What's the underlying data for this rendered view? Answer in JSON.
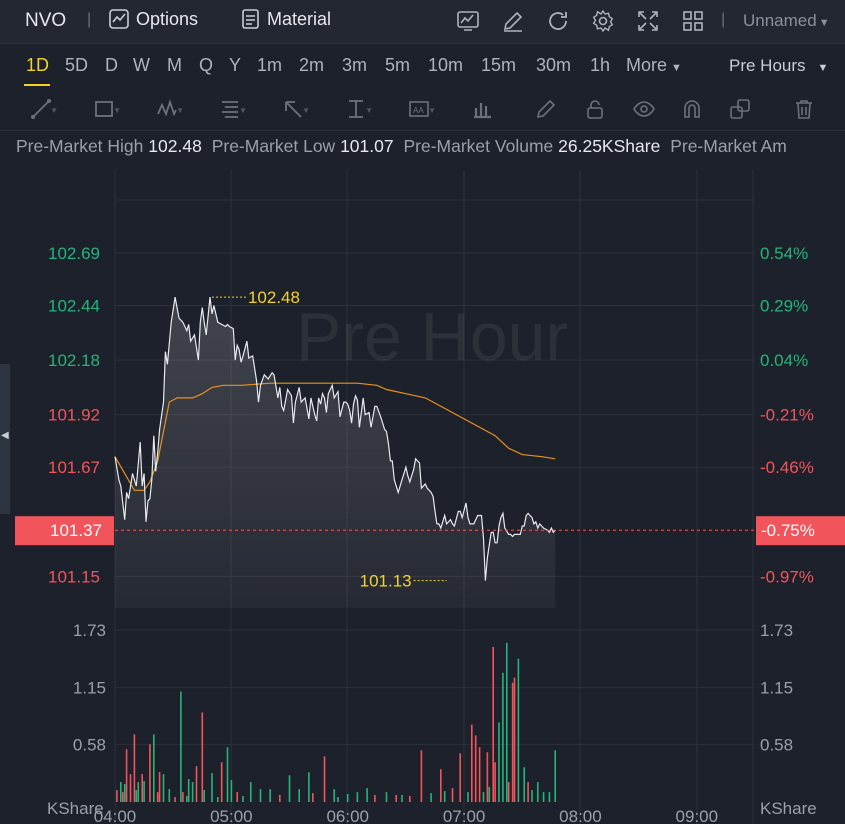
{
  "header": {
    "symbol": "NVO",
    "options_label": "Options",
    "material_label": "Material",
    "layout_name": "Unnamed",
    "icons": [
      "chart-icon",
      "edit-icon",
      "refresh-icon",
      "settings-icon",
      "fullscreen-icon",
      "grid-icon"
    ]
  },
  "timeframes": {
    "items": [
      "1D",
      "5D",
      "D",
      "W",
      "M",
      "Q",
      "Y",
      "1m",
      "2m",
      "3m",
      "5m",
      "10m",
      "15m",
      "30m",
      "1h"
    ],
    "active": "1D",
    "more_label": "More",
    "session_label": "Pre Hours"
  },
  "drawing_tools": [
    "trendline-icon",
    "rectangle-icon",
    "wave-icon",
    "fib-icon",
    "arrow-icon",
    "measure-icon",
    "text-icon",
    "bars-icon",
    "pencil-icon",
    "lock-icon",
    "eye-icon",
    "magnet-icon",
    "layers-icon",
    "trash-icon"
  ],
  "stats": {
    "high_label": "Pre-Market High",
    "high_value": "102.48",
    "low_label": "Pre-Market Low",
    "low_value": "101.07",
    "volume_label": "Pre-Market Volume",
    "volume_value": "26.25KShare",
    "amount_label": "Pre-Market Am"
  },
  "colors": {
    "up": "#26b47a",
    "down": "#f2545b",
    "price_line": "#e6e8ee",
    "avg_line": "#e8921c",
    "marker": "#f4d22b",
    "bg": "#1d212b"
  },
  "chart_data": {
    "type": "line",
    "watermark": "Pre Hour",
    "current_price": "101.37",
    "current_pct": "-0.75%",
    "price_axis_left": [
      {
        "label": "102.69",
        "value": 102.69,
        "dir": "up"
      },
      {
        "label": "102.44",
        "value": 102.44,
        "dir": "up"
      },
      {
        "label": "102.18",
        "value": 102.18,
        "dir": "up"
      },
      {
        "label": "101.92",
        "value": 101.92,
        "dir": "down"
      },
      {
        "label": "101.67",
        "value": 101.67,
        "dir": "down"
      },
      {
        "label": "101.15",
        "value": 101.15,
        "dir": "down"
      }
    ],
    "price_axis_right": [
      "0.54%",
      "0.29%",
      "0.04%",
      "-0.21%",
      "-0.46%",
      "-0.97%"
    ],
    "x_ticks": [
      "04:00",
      "05:00",
      "06:00",
      "07:00",
      "08:00",
      "09:00"
    ],
    "x_range_minutes": [
      0,
      330
    ],
    "y_range": [
      101.0,
      102.8
    ],
    "max_marker": {
      "label": "102.48",
      "t": 50,
      "v": 102.48
    },
    "min_marker": {
      "label": "101.13",
      "t": 171,
      "v": 101.13
    },
    "price_series": [
      [
        0,
        101.72
      ],
      [
        2,
        101.61
      ],
      [
        3,
        101.58
      ],
      [
        5,
        101.42
      ],
      [
        6,
        101.55
      ],
      [
        7,
        101.52
      ],
      [
        9,
        101.64
      ],
      [
        11,
        101.58
      ],
      [
        13,
        101.79
      ],
      [
        14,
        101.58
      ],
      [
        15,
        101.64
      ],
      [
        16,
        101.41
      ],
      [
        17,
        101.51
      ],
      [
        18,
        101.52
      ],
      [
        19,
        101.61
      ],
      [
        20,
        101.82
      ],
      [
        21,
        101.65
      ],
      [
        22,
        101.74
      ],
      [
        23,
        101.85
      ],
      [
        25,
        101.98
      ],
      [
        26,
        102.22
      ],
      [
        27,
        102.16
      ],
      [
        29,
        102.36
      ],
      [
        31,
        102.48
      ],
      [
        33,
        102.38
      ],
      [
        35,
        102.36
      ],
      [
        37,
        102.32
      ],
      [
        38,
        102.35
      ],
      [
        39,
        102.27
      ],
      [
        41,
        102.3
      ],
      [
        43,
        102.18
      ],
      [
        44,
        102.36
      ],
      [
        45,
        102.43
      ],
      [
        46,
        102.36
      ],
      [
        47,
        102.3
      ],
      [
        49,
        102.48
      ],
      [
        50,
        102.4
      ],
      [
        51,
        102.44
      ],
      [
        53,
        102.36
      ],
      [
        55,
        102.35
      ],
      [
        57,
        102.34
      ],
      [
        58,
        102.35
      ],
      [
        59,
        102.34
      ],
      [
        61,
        102.33
      ],
      [
        62,
        102.18
      ],
      [
        63,
        102.25
      ],
      [
        64,
        102.23
      ],
      [
        65,
        102.17
      ],
      [
        66,
        102.2
      ],
      [
        68,
        102.27
      ],
      [
        69,
        102.19
      ],
      [
        71,
        102.2
      ],
      [
        73,
        102.08
      ],
      [
        74,
        101.98
      ],
      [
        75,
        102.06
      ],
      [
        77,
        102.11
      ],
      [
        79,
        102.09
      ],
      [
        81,
        102.12
      ],
      [
        82,
        102.11
      ],
      [
        84,
        102.0
      ],
      [
        85,
        102.05
      ],
      [
        86,
        101.96
      ],
      [
        87,
        101.94
      ],
      [
        89,
        102.04
      ],
      [
        91,
        102.01
      ],
      [
        92,
        101.88
      ],
      [
        93,
        101.98
      ],
      [
        95,
        102.05
      ],
      [
        96,
        101.98
      ],
      [
        98,
        102.0
      ],
      [
        100,
        101.9
      ],
      [
        101,
        102.0
      ],
      [
        102,
        101.96
      ],
      [
        103,
        101.92
      ],
      [
        104,
        101.89
      ],
      [
        105,
        102.0
      ],
      [
        106,
        101.97
      ],
      [
        107,
        102.02
      ],
      [
        108,
        102.0
      ],
      [
        109,
        101.93
      ],
      [
        110,
        102.02
      ],
      [
        112,
        102.06
      ],
      [
        113,
        102.0
      ],
      [
        115,
        102.03
      ],
      [
        116,
        101.91
      ],
      [
        118,
        101.98
      ],
      [
        119,
        101.98
      ],
      [
        120,
        101.97
      ],
      [
        121,
        101.94
      ],
      [
        122,
        101.88
      ],
      [
        123,
        101.97
      ],
      [
        124,
        102.01
      ],
      [
        125,
        101.99
      ],
      [
        126,
        101.86
      ],
      [
        127,
        101.93
      ],
      [
        128,
        102.0
      ],
      [
        129,
        101.92
      ],
      [
        131,
        101.93
      ],
      [
        132,
        101.86
      ],
      [
        134,
        101.96
      ],
      [
        135,
        101.96
      ],
      [
        137,
        101.91
      ],
      [
        139,
        101.85
      ],
      [
        140,
        101.84
      ],
      [
        141,
        101.78
      ],
      [
        142,
        101.7
      ],
      [
        143,
        101.7
      ],
      [
        144,
        101.61
      ],
      [
        146,
        101.55
      ],
      [
        148,
        101.61
      ],
      [
        150,
        101.67
      ],
      [
        151,
        101.63
      ],
      [
        152,
        101.6
      ],
      [
        154,
        101.66
      ],
      [
        155,
        101.71
      ],
      [
        157,
        101.69
      ],
      [
        158,
        101.57
      ],
      [
        160,
        101.59
      ],
      [
        161,
        101.57
      ],
      [
        163,
        101.55
      ],
      [
        164,
        101.53
      ],
      [
        165,
        101.46
      ],
      [
        166,
        101.4
      ],
      [
        167,
        101.4
      ],
      [
        168,
        101.38
      ],
      [
        170,
        101.44
      ],
      [
        171,
        101.4
      ],
      [
        173,
        101.42
      ],
      [
        174,
        101.4
      ],
      [
        175,
        101.39
      ],
      [
        177,
        101.46
      ],
      [
        178,
        101.46
      ],
      [
        179,
        101.43
      ],
      [
        181,
        101.5
      ],
      [
        182,
        101.43
      ],
      [
        183,
        101.4
      ],
      [
        185,
        101.4
      ],
      [
        186,
        101.42
      ],
      [
        187,
        101.44
      ],
      [
        189,
        101.44
      ],
      [
        190,
        101.33
      ],
      [
        191,
        101.13
      ],
      [
        192,
        101.24
      ],
      [
        193,
        101.3
      ],
      [
        194,
        101.36
      ],
      [
        195,
        101.36
      ],
      [
        196,
        101.31
      ],
      [
        197,
        101.31
      ],
      [
        198,
        101.39
      ],
      [
        199,
        101.43
      ],
      [
        200,
        101.45
      ],
      [
        201,
        101.38
      ],
      [
        203,
        101.35
      ],
      [
        204,
        101.35
      ],
      [
        205,
        101.34
      ],
      [
        206,
        101.35
      ],
      [
        207,
        101.35
      ],
      [
        209,
        101.35
      ],
      [
        210,
        101.39
      ],
      [
        211,
        101.39
      ],
      [
        212,
        101.44
      ],
      [
        213,
        101.45
      ],
      [
        214,
        101.44
      ],
      [
        215,
        101.43
      ],
      [
        216,
        101.4
      ],
      [
        217,
        101.41
      ],
      [
        218,
        101.38
      ],
      [
        219,
        101.4
      ],
      [
        221,
        101.38
      ],
      [
        223,
        101.37
      ],
      [
        224,
        101.36
      ],
      [
        225,
        101.38
      ],
      [
        226,
        101.36
      ],
      [
        227,
        101.37
      ]
    ],
    "avg_series": [
      [
        0,
        101.72
      ],
      [
        10,
        101.56
      ],
      [
        15,
        101.56
      ],
      [
        18,
        101.6
      ],
      [
        22,
        101.7
      ],
      [
        28,
        101.98
      ],
      [
        32,
        102.0
      ],
      [
        40,
        102.0
      ],
      [
        45,
        102.02
      ],
      [
        50,
        102.05
      ],
      [
        56,
        102.06
      ],
      [
        65,
        102.06
      ],
      [
        80,
        102.07
      ],
      [
        100,
        102.07
      ],
      [
        125,
        102.07
      ],
      [
        135,
        102.06
      ],
      [
        140,
        102.04
      ],
      [
        150,
        102.02
      ],
      [
        160,
        102.0
      ],
      [
        170,
        101.95
      ],
      [
        180,
        101.9
      ],
      [
        190,
        101.85
      ],
      [
        196,
        101.82
      ],
      [
        203,
        101.76
      ],
      [
        210,
        101.73
      ],
      [
        220,
        101.72
      ],
      [
        227,
        101.71
      ]
    ],
    "volume_axis": [
      "1.73",
      "1.15",
      "0.58",
      "KShare"
    ],
    "volume_max": 1.9,
    "volume": [
      [
        1,
        0.12,
        "down"
      ],
      [
        3,
        0.2,
        "up"
      ],
      [
        4,
        0.1,
        "down"
      ],
      [
        5,
        0.18,
        "up"
      ],
      [
        6,
        0.53,
        "down"
      ],
      [
        8,
        0.28,
        "down"
      ],
      [
        10,
        0.68,
        "down"
      ],
      [
        11,
        0.12,
        "up"
      ],
      [
        12,
        0.2,
        "up"
      ],
      [
        14,
        0.28,
        "down"
      ],
      [
        15,
        0.21,
        "up"
      ],
      [
        18,
        0.58,
        "down"
      ],
      [
        20,
        0.68,
        "up"
      ],
      [
        22,
        0.1,
        "down"
      ],
      [
        23,
        0.3,
        "down"
      ],
      [
        25,
        0.28,
        "up"
      ],
      [
        28,
        0.13,
        "up"
      ],
      [
        31,
        0.05,
        "down"
      ],
      [
        34,
        1.11,
        "up"
      ],
      [
        35,
        0.1,
        "down"
      ],
      [
        37,
        0.06,
        "up"
      ],
      [
        38,
        0.23,
        "up"
      ],
      [
        40,
        0.2,
        "up"
      ],
      [
        42,
        0.36,
        "down"
      ],
      [
        45,
        0.9,
        "down"
      ],
      [
        46,
        0.12,
        "up"
      ],
      [
        50,
        0.29,
        "up"
      ],
      [
        53,
        0.05,
        "up"
      ],
      [
        55,
        0.4,
        "down"
      ],
      [
        58,
        0.55,
        "up"
      ],
      [
        60,
        0.22,
        "up"
      ],
      [
        63,
        0.1,
        "down"
      ],
      [
        66,
        0.06,
        "up"
      ],
      [
        70,
        0.2,
        "up"
      ],
      [
        75,
        0.13,
        "up"
      ],
      [
        80,
        0.13,
        "up"
      ],
      [
        85,
        0.07,
        "down"
      ],
      [
        90,
        0.27,
        "up"
      ],
      [
        95,
        0.13,
        "up"
      ],
      [
        100,
        0.3,
        "up"
      ],
      [
        102,
        0.09,
        "down"
      ],
      [
        108,
        0.46,
        "down"
      ],
      [
        113,
        0.13,
        "up"
      ],
      [
        115,
        0.05,
        "up"
      ],
      [
        120,
        0.08,
        "up"
      ],
      [
        125,
        0.1,
        "up"
      ],
      [
        130,
        0.14,
        "up"
      ],
      [
        134,
        0.07,
        "down"
      ],
      [
        140,
        0.1,
        "up"
      ],
      [
        145,
        0.07,
        "down"
      ],
      [
        148,
        0.07,
        "up"
      ],
      [
        152,
        0.06,
        "down"
      ],
      [
        158,
        0.52,
        "down"
      ],
      [
        163,
        0.09,
        "up"
      ],
      [
        168,
        0.33,
        "down"
      ],
      [
        170,
        0.11,
        "up"
      ],
      [
        174,
        0.14,
        "down"
      ],
      [
        178,
        0.49,
        "down"
      ],
      [
        182,
        0.1,
        "up"
      ],
      [
        184,
        0.78,
        "down"
      ],
      [
        186,
        0.67,
        "down"
      ],
      [
        188,
        0.55,
        "down"
      ],
      [
        190,
        0.1,
        "up"
      ],
      [
        192,
        0.5,
        "down"
      ],
      [
        193,
        0.15,
        "up"
      ],
      [
        195,
        1.56,
        "down"
      ],
      [
        196,
        0.4,
        "down"
      ],
      [
        198,
        0.8,
        "up"
      ],
      [
        200,
        1.3,
        "up"
      ],
      [
        202,
        1.6,
        "up"
      ],
      [
        203,
        0.2,
        "down"
      ],
      [
        205,
        1.2,
        "down"
      ],
      [
        206,
        1.25,
        "down"
      ],
      [
        208,
        1.44,
        "up"
      ],
      [
        211,
        0.35,
        "up"
      ],
      [
        213,
        0.2,
        "down"
      ],
      [
        215,
        0.12,
        "up"
      ],
      [
        218,
        0.2,
        "up"
      ],
      [
        221,
        0.1,
        "up"
      ],
      [
        224,
        0.1,
        "up"
      ],
      [
        227,
        0.52,
        "up"
      ]
    ]
  }
}
